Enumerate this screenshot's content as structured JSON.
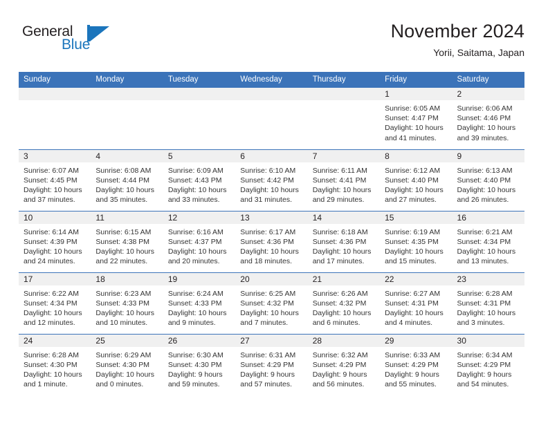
{
  "brand": {
    "word_one": "General",
    "word_two": "Blue",
    "logo_icon": "general-blue-triangle-logo",
    "accent_color": "#1b75bc"
  },
  "header": {
    "title": "November 2024",
    "subtitle": "Yorii, Saitama, Japan"
  },
  "theme": {
    "header_blue": "#3b73b9",
    "daynum_band": "#f0f0f0",
    "text": "#231f20"
  },
  "weekday_headers": [
    "Sunday",
    "Monday",
    "Tuesday",
    "Wednesday",
    "Thursday",
    "Friday",
    "Saturday"
  ],
  "weeks": [
    [
      {
        "day": "",
        "sunrise": "",
        "sunset": "",
        "daylight_line1": "",
        "daylight_line2": ""
      },
      {
        "day": "",
        "sunrise": "",
        "sunset": "",
        "daylight_line1": "",
        "daylight_line2": ""
      },
      {
        "day": "",
        "sunrise": "",
        "sunset": "",
        "daylight_line1": "",
        "daylight_line2": ""
      },
      {
        "day": "",
        "sunrise": "",
        "sunset": "",
        "daylight_line1": "",
        "daylight_line2": ""
      },
      {
        "day": "",
        "sunrise": "",
        "sunset": "",
        "daylight_line1": "",
        "daylight_line2": ""
      },
      {
        "day": "1",
        "sunrise": "Sunrise: 6:05 AM",
        "sunset": "Sunset: 4:47 PM",
        "daylight_line1": "Daylight: 10 hours",
        "daylight_line2": "and 41 minutes."
      },
      {
        "day": "2",
        "sunrise": "Sunrise: 6:06 AM",
        "sunset": "Sunset: 4:46 PM",
        "daylight_line1": "Daylight: 10 hours",
        "daylight_line2": "and 39 minutes."
      }
    ],
    [
      {
        "day": "3",
        "sunrise": "Sunrise: 6:07 AM",
        "sunset": "Sunset: 4:45 PM",
        "daylight_line1": "Daylight: 10 hours",
        "daylight_line2": "and 37 minutes."
      },
      {
        "day": "4",
        "sunrise": "Sunrise: 6:08 AM",
        "sunset": "Sunset: 4:44 PM",
        "daylight_line1": "Daylight: 10 hours",
        "daylight_line2": "and 35 minutes."
      },
      {
        "day": "5",
        "sunrise": "Sunrise: 6:09 AM",
        "sunset": "Sunset: 4:43 PM",
        "daylight_line1": "Daylight: 10 hours",
        "daylight_line2": "and 33 minutes."
      },
      {
        "day": "6",
        "sunrise": "Sunrise: 6:10 AM",
        "sunset": "Sunset: 4:42 PM",
        "daylight_line1": "Daylight: 10 hours",
        "daylight_line2": "and 31 minutes."
      },
      {
        "day": "7",
        "sunrise": "Sunrise: 6:11 AM",
        "sunset": "Sunset: 4:41 PM",
        "daylight_line1": "Daylight: 10 hours",
        "daylight_line2": "and 29 minutes."
      },
      {
        "day": "8",
        "sunrise": "Sunrise: 6:12 AM",
        "sunset": "Sunset: 4:40 PM",
        "daylight_line1": "Daylight: 10 hours",
        "daylight_line2": "and 27 minutes."
      },
      {
        "day": "9",
        "sunrise": "Sunrise: 6:13 AM",
        "sunset": "Sunset: 4:40 PM",
        "daylight_line1": "Daylight: 10 hours",
        "daylight_line2": "and 26 minutes."
      }
    ],
    [
      {
        "day": "10",
        "sunrise": "Sunrise: 6:14 AM",
        "sunset": "Sunset: 4:39 PM",
        "daylight_line1": "Daylight: 10 hours",
        "daylight_line2": "and 24 minutes."
      },
      {
        "day": "11",
        "sunrise": "Sunrise: 6:15 AM",
        "sunset": "Sunset: 4:38 PM",
        "daylight_line1": "Daylight: 10 hours",
        "daylight_line2": "and 22 minutes."
      },
      {
        "day": "12",
        "sunrise": "Sunrise: 6:16 AM",
        "sunset": "Sunset: 4:37 PM",
        "daylight_line1": "Daylight: 10 hours",
        "daylight_line2": "and 20 minutes."
      },
      {
        "day": "13",
        "sunrise": "Sunrise: 6:17 AM",
        "sunset": "Sunset: 4:36 PM",
        "daylight_line1": "Daylight: 10 hours",
        "daylight_line2": "and 18 minutes."
      },
      {
        "day": "14",
        "sunrise": "Sunrise: 6:18 AM",
        "sunset": "Sunset: 4:36 PM",
        "daylight_line1": "Daylight: 10 hours",
        "daylight_line2": "and 17 minutes."
      },
      {
        "day": "15",
        "sunrise": "Sunrise: 6:19 AM",
        "sunset": "Sunset: 4:35 PM",
        "daylight_line1": "Daylight: 10 hours",
        "daylight_line2": "and 15 minutes."
      },
      {
        "day": "16",
        "sunrise": "Sunrise: 6:21 AM",
        "sunset": "Sunset: 4:34 PM",
        "daylight_line1": "Daylight: 10 hours",
        "daylight_line2": "and 13 minutes."
      }
    ],
    [
      {
        "day": "17",
        "sunrise": "Sunrise: 6:22 AM",
        "sunset": "Sunset: 4:34 PM",
        "daylight_line1": "Daylight: 10 hours",
        "daylight_line2": "and 12 minutes."
      },
      {
        "day": "18",
        "sunrise": "Sunrise: 6:23 AM",
        "sunset": "Sunset: 4:33 PM",
        "daylight_line1": "Daylight: 10 hours",
        "daylight_line2": "and 10 minutes."
      },
      {
        "day": "19",
        "sunrise": "Sunrise: 6:24 AM",
        "sunset": "Sunset: 4:33 PM",
        "daylight_line1": "Daylight: 10 hours",
        "daylight_line2": "and 9 minutes."
      },
      {
        "day": "20",
        "sunrise": "Sunrise: 6:25 AM",
        "sunset": "Sunset: 4:32 PM",
        "daylight_line1": "Daylight: 10 hours",
        "daylight_line2": "and 7 minutes."
      },
      {
        "day": "21",
        "sunrise": "Sunrise: 6:26 AM",
        "sunset": "Sunset: 4:32 PM",
        "daylight_line1": "Daylight: 10 hours",
        "daylight_line2": "and 6 minutes."
      },
      {
        "day": "22",
        "sunrise": "Sunrise: 6:27 AM",
        "sunset": "Sunset: 4:31 PM",
        "daylight_line1": "Daylight: 10 hours",
        "daylight_line2": "and 4 minutes."
      },
      {
        "day": "23",
        "sunrise": "Sunrise: 6:28 AM",
        "sunset": "Sunset: 4:31 PM",
        "daylight_line1": "Daylight: 10 hours",
        "daylight_line2": "and 3 minutes."
      }
    ],
    [
      {
        "day": "24",
        "sunrise": "Sunrise: 6:28 AM",
        "sunset": "Sunset: 4:30 PM",
        "daylight_line1": "Daylight: 10 hours",
        "daylight_line2": "and 1 minute."
      },
      {
        "day": "25",
        "sunrise": "Sunrise: 6:29 AM",
        "sunset": "Sunset: 4:30 PM",
        "daylight_line1": "Daylight: 10 hours",
        "daylight_line2": "and 0 minutes."
      },
      {
        "day": "26",
        "sunrise": "Sunrise: 6:30 AM",
        "sunset": "Sunset: 4:30 PM",
        "daylight_line1": "Daylight: 9 hours",
        "daylight_line2": "and 59 minutes."
      },
      {
        "day": "27",
        "sunrise": "Sunrise: 6:31 AM",
        "sunset": "Sunset: 4:29 PM",
        "daylight_line1": "Daylight: 9 hours",
        "daylight_line2": "and 57 minutes."
      },
      {
        "day": "28",
        "sunrise": "Sunrise: 6:32 AM",
        "sunset": "Sunset: 4:29 PM",
        "daylight_line1": "Daylight: 9 hours",
        "daylight_line2": "and 56 minutes."
      },
      {
        "day": "29",
        "sunrise": "Sunrise: 6:33 AM",
        "sunset": "Sunset: 4:29 PM",
        "daylight_line1": "Daylight: 9 hours",
        "daylight_line2": "and 55 minutes."
      },
      {
        "day": "30",
        "sunrise": "Sunrise: 6:34 AM",
        "sunset": "Sunset: 4:29 PM",
        "daylight_line1": "Daylight: 9 hours",
        "daylight_line2": "and 54 minutes."
      }
    ]
  ]
}
